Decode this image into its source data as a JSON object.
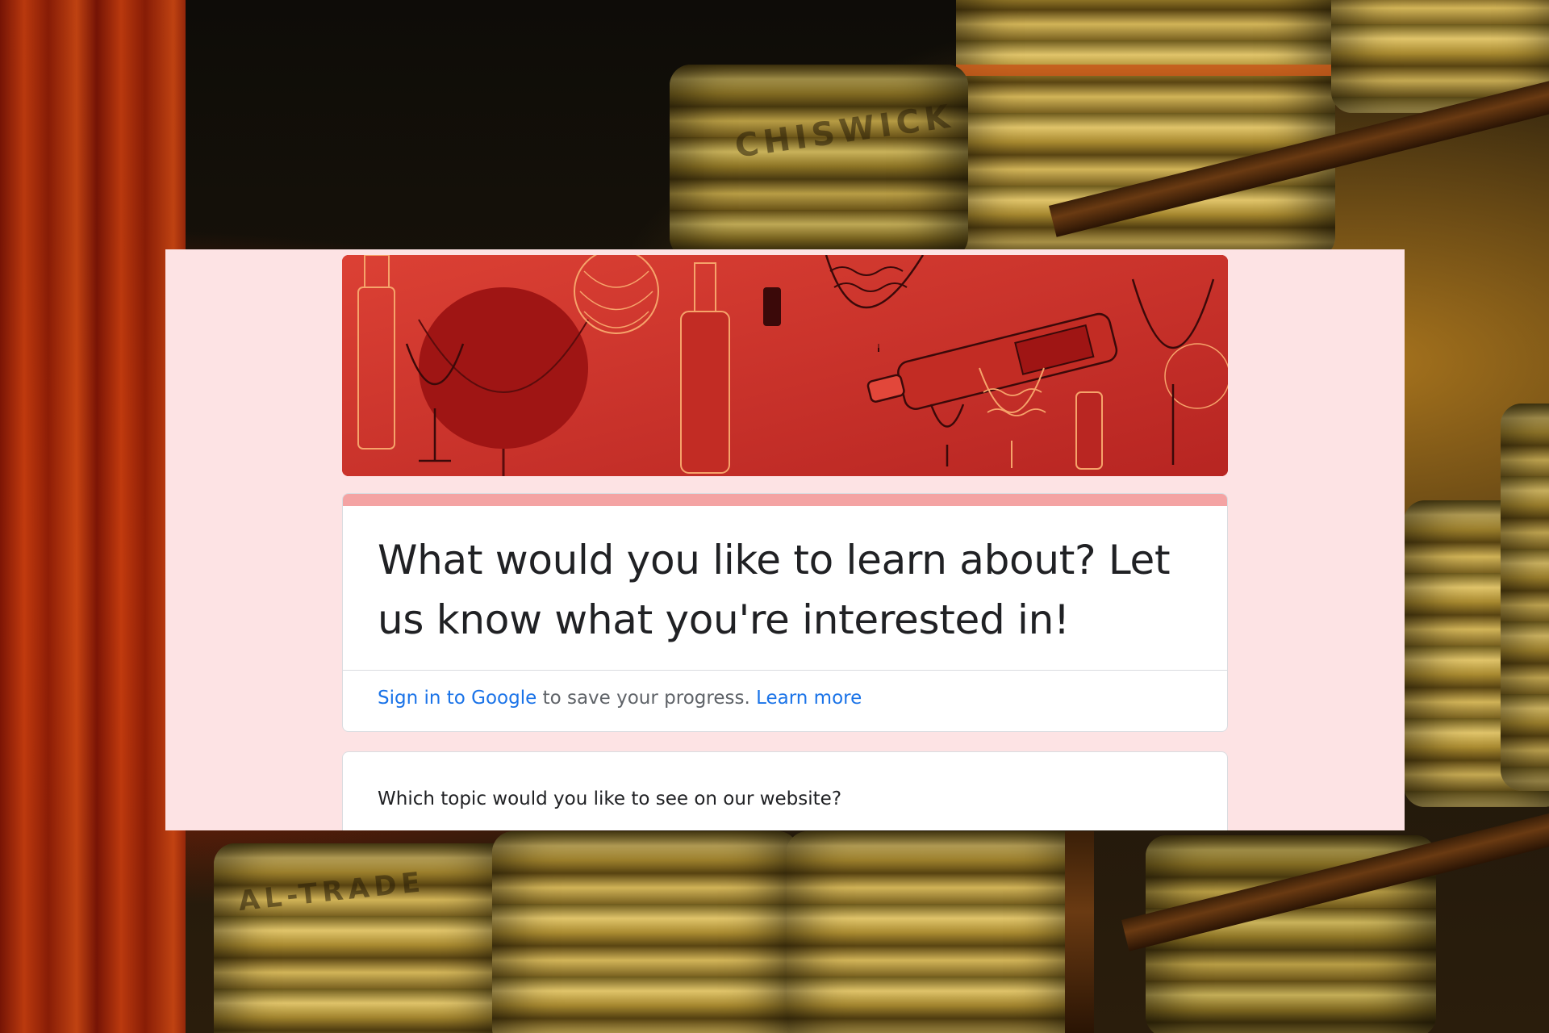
{
  "form": {
    "title": "What would you like to learn about? Let us know what you're interested in!",
    "signin": {
      "link_text": "Sign in to Google",
      "middle_text": " to save your progress. ",
      "learn_more": "Learn more"
    },
    "questions": [
      {
        "label": "Which topic would you like to see on our website?"
      }
    ]
  },
  "background": {
    "keg_labels": [
      "CHISWICK",
      "AL-TRADE"
    ]
  },
  "colors": {
    "panel_bg": "#fde3e4",
    "accent": "#f4a3a3",
    "banner": "#d2372c",
    "link": "#1a73e8",
    "text": "#202124"
  },
  "icons": {
    "banner": "wine-glasses-illustration"
  }
}
